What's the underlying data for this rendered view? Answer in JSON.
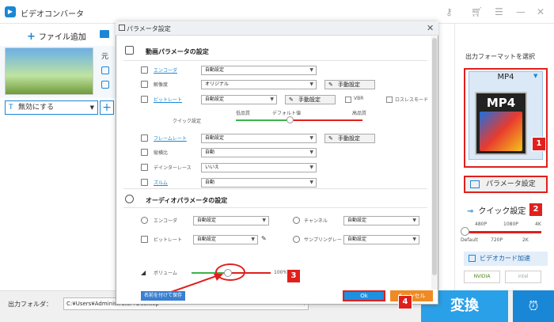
{
  "app": {
    "title": "ビデオコンバータ",
    "add_file": "ファイル追加",
    "preview_label": "元"
  },
  "left": {
    "disable_label": "無効にする"
  },
  "right": {
    "format_title": "出力フォーマットを選択",
    "format_name": "MP4",
    "logo_text": "MP4",
    "param_button": "パラメータ設定",
    "quick_label": "クイック設定",
    "quick_ticks_top": [
      "480P",
      "1080P",
      "4K"
    ],
    "quick_ticks_bottom": [
      "Default",
      "720P",
      "2K"
    ],
    "gpu_label": "ビデオカード加速",
    "gpu_nvidia": "NVIDIA",
    "gpu_intel": "intel"
  },
  "bottom": {
    "output_label": "出力フォルダ：",
    "output_path": "C:¥Users¥Administrator¥Desktop",
    "convert": "変換"
  },
  "dialog": {
    "title": "パラメータ設定",
    "video_section": "動画パラメータの設定",
    "video_rows": [
      {
        "label": "エンコーダ",
        "value": "自動設定",
        "link": true
      },
      {
        "label": "解像度",
        "value": "オリジナル",
        "button": "手動設定",
        "link": false
      },
      {
        "label": "ビットレート",
        "value": "自動設定",
        "button": "手動設定",
        "link": true,
        "check1": "VBR",
        "check2": "ロスレスモード"
      },
      {
        "label": "フレームレート",
        "value": "自動設定",
        "button": "手動設定",
        "link": true
      },
      {
        "label": "縦横比",
        "value": "自動",
        "link": false
      },
      {
        "label": "デインターレース",
        "value": "いいえ",
        "link": false
      },
      {
        "label": "ズルム",
        "value": "自動",
        "link": true
      }
    ],
    "quick": {
      "label": "クイック設定",
      "low": "低品質",
      "default": "デフォルト値",
      "high": "高品質"
    },
    "audio_section": "オーディオパラメータの設定",
    "audio_rows": [
      {
        "label": "エンコーダ",
        "value": "自動設定",
        "label2": "チャンネル",
        "value2": "自動設定"
      },
      {
        "label": "ビットレート",
        "value": "自動設定",
        "label2": "サンプリングレート",
        "value2": "自動設定"
      }
    ],
    "volume": {
      "label": "ボリューム",
      "value": "100%",
      "level": 0.46
    },
    "rename_button": "名前を付けて保存",
    "ok": "Ok",
    "cancel": "キャンセル"
  },
  "badges": [
    "1",
    "2",
    "3",
    "4"
  ],
  "colors": {
    "accent": "#1a87d6",
    "highlight": "#e0201d",
    "cancel": "#f08a24"
  }
}
